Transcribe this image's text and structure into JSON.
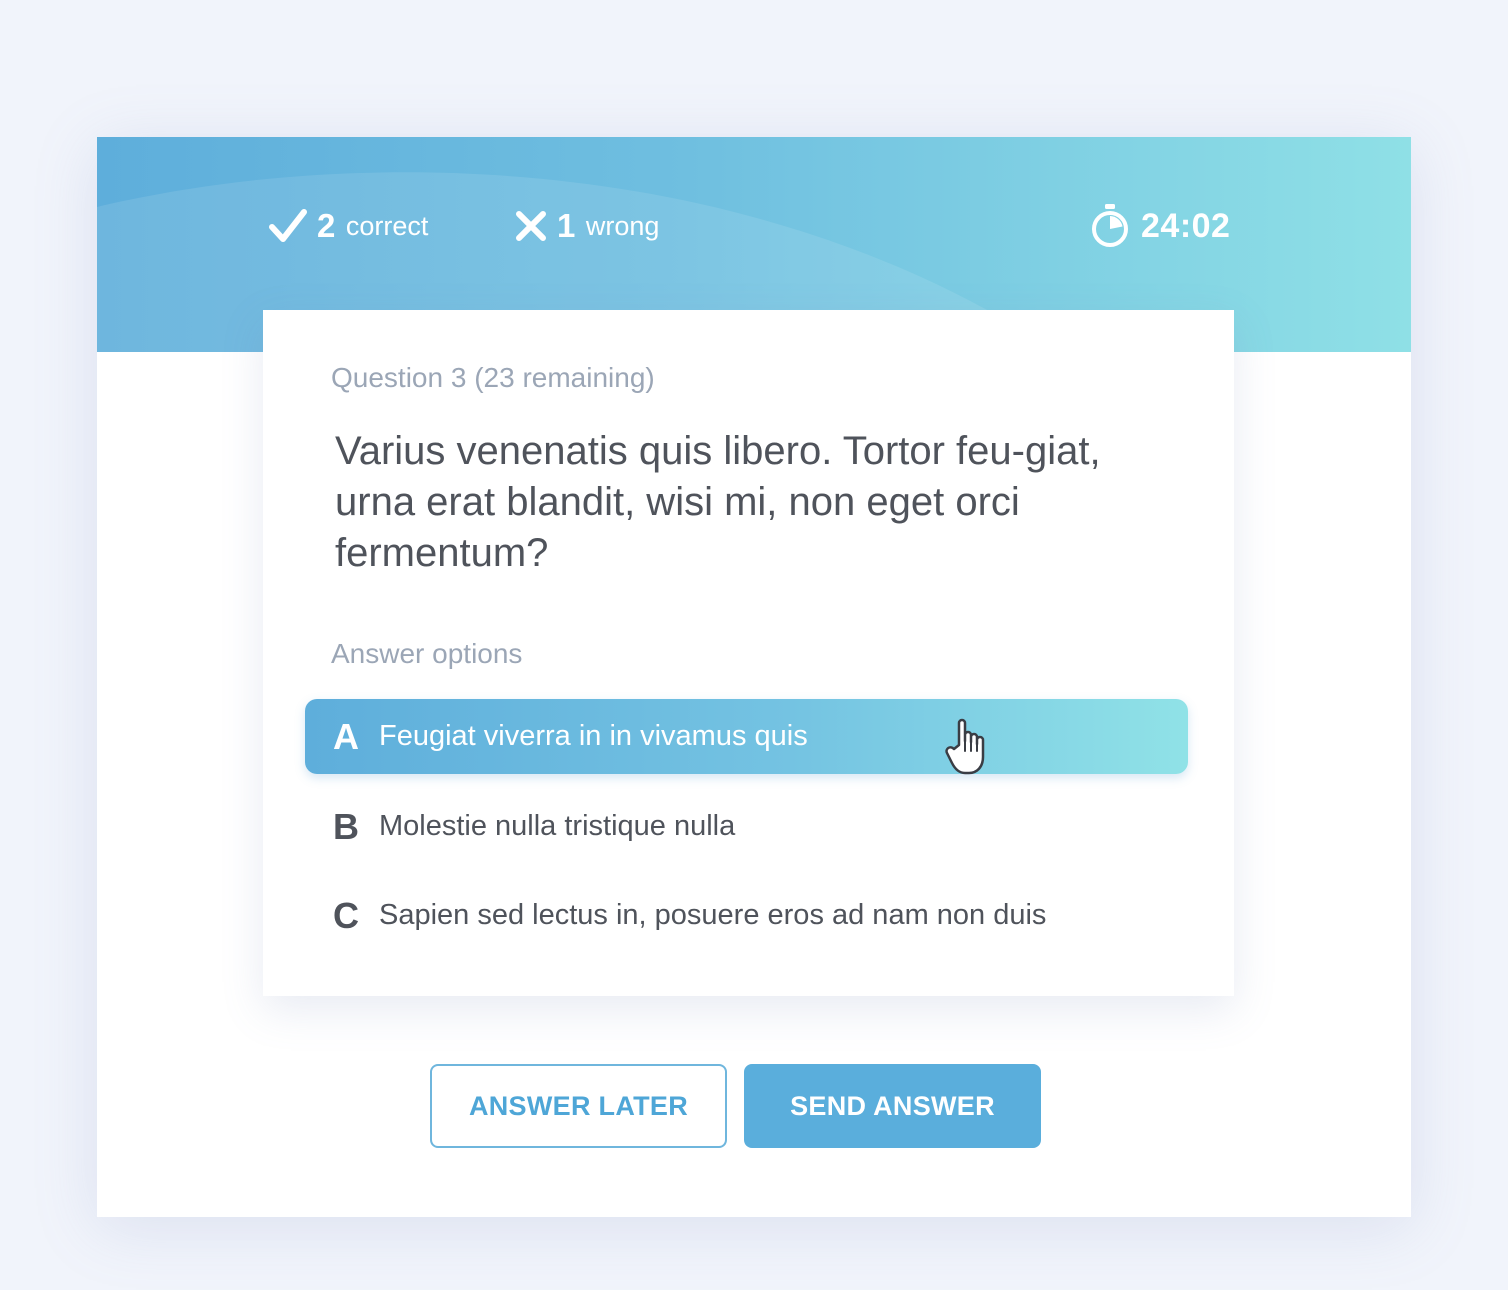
{
  "header": {
    "correct": {
      "count": "2",
      "label": "correct"
    },
    "wrong": {
      "count": "1",
      "label": "wrong"
    },
    "timer": "24:02"
  },
  "question": {
    "meta": "Question 3 (23 remaining)",
    "text": "Varius venenatis quis libero. Tortor feu-giat, urna erat blandit, wisi mi, non eget orci fermentum?"
  },
  "answers": {
    "label": "Answer options",
    "options": [
      {
        "letter": "A",
        "text": "Feugiat viverra in in vivamus quis",
        "selected": true
      },
      {
        "letter": "B",
        "text": "Molestie nulla tristique nulla",
        "selected": false
      },
      {
        "letter": "C",
        "text": "Sapien sed lectus in, posuere eros ad nam non duis",
        "selected": false
      }
    ]
  },
  "actions": {
    "later_label": "ANSWER LATER",
    "send_label": "SEND ANSWER"
  },
  "colors": {
    "accent": "#5aaedc",
    "accent_light": "#90e2e7",
    "text_dark": "#4f535b",
    "text_muted": "#9ba6b6",
    "background": "#f1f4fb"
  },
  "icons": {
    "correct": "checkmark-icon",
    "wrong": "cross-icon",
    "timer": "stopwatch-icon",
    "cursor": "hand-pointer-icon"
  }
}
